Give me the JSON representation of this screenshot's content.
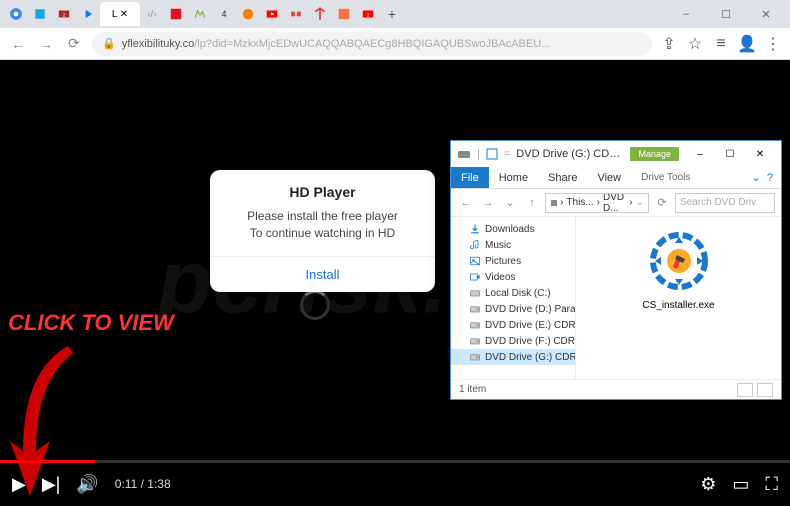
{
  "browser": {
    "url_host": "yflexibilituky.co",
    "url_path": "/lp?did=MzkxMjcEDwUCAQQABQAECg8HBQIGAQUBSwoJBAcABEU...",
    "new_tab": "+",
    "window": {
      "min": "–",
      "max": "☐",
      "close": "✕"
    }
  },
  "clickview": {
    "text": "CLICK TO VIEW"
  },
  "watermark": "pcrisk.com",
  "dialog": {
    "title": "HD Player",
    "line1": "Please install the free player",
    "line2": "To continue watching in HD",
    "button": "Install"
  },
  "player": {
    "time_current": "0:11",
    "time_total": "1:38"
  },
  "explorer": {
    "title_prefix": "DVD Drive (G:) CDROM...",
    "manage": "Manage",
    "ribbon": {
      "file": "File",
      "home": "Home",
      "share": "Share",
      "view": "View",
      "tools": "Drive Tools",
      "help": "?"
    },
    "down_arrow": "⌄",
    "breadcrumb": {
      "p1": "This...",
      "p2": "DVD D..."
    },
    "search_placeholder": "Search DVD Driv",
    "tree": [
      {
        "label": "Downloads",
        "icon": "download"
      },
      {
        "label": "Music",
        "icon": "music"
      },
      {
        "label": "Pictures",
        "icon": "pictures"
      },
      {
        "label": "Videos",
        "icon": "video"
      },
      {
        "label": "Local Disk (C:)",
        "icon": "disk"
      },
      {
        "label": "DVD Drive (D:) Parallel",
        "icon": "dvd"
      },
      {
        "label": "DVD Drive (E:) CDROM",
        "icon": "dvd"
      },
      {
        "label": "DVD Drive (F:) CDROM",
        "icon": "dvd"
      },
      {
        "label": "DVD Drive (G:) CDROM",
        "icon": "dvd",
        "selected": true
      }
    ],
    "file": {
      "name": "CS_installer.exe"
    },
    "status": "1 item",
    "window": {
      "min": "–",
      "max": "☐",
      "close": "✕"
    }
  }
}
